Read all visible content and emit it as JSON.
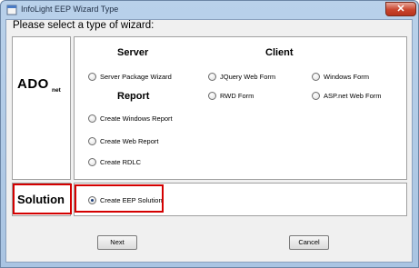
{
  "window": {
    "title": "InfoLight EEP Wizard Type",
    "close_glyph": "✕",
    "app_icon": "app-icon"
  },
  "prompt": "Please select a type of wizard:",
  "ado": {
    "main": "ADO",
    "sub": "net"
  },
  "groups": {
    "server": "Server",
    "client": "Client",
    "report": "Report"
  },
  "options": {
    "server_package": "Server Package Wizard",
    "jquery_web_form": "JQuery Web Form",
    "windows_form": "Windows Form",
    "rwd_form": "RWD Form",
    "aspnet_web_form": "ASP.net Web Form",
    "create_windows_report": "Create Windows Report",
    "create_web_report": "Create Web Report",
    "create_rdlc": "Create RDLC",
    "create_eep_solution": "Create EEP Solution"
  },
  "selected_option": "create_eep_solution",
  "solution_label": "Solution",
  "buttons": {
    "next": "Next",
    "cancel": "Cancel"
  },
  "colors": {
    "highlight": "#d40000",
    "titlebar": "#b9d1ea",
    "close": "#c9442d"
  }
}
